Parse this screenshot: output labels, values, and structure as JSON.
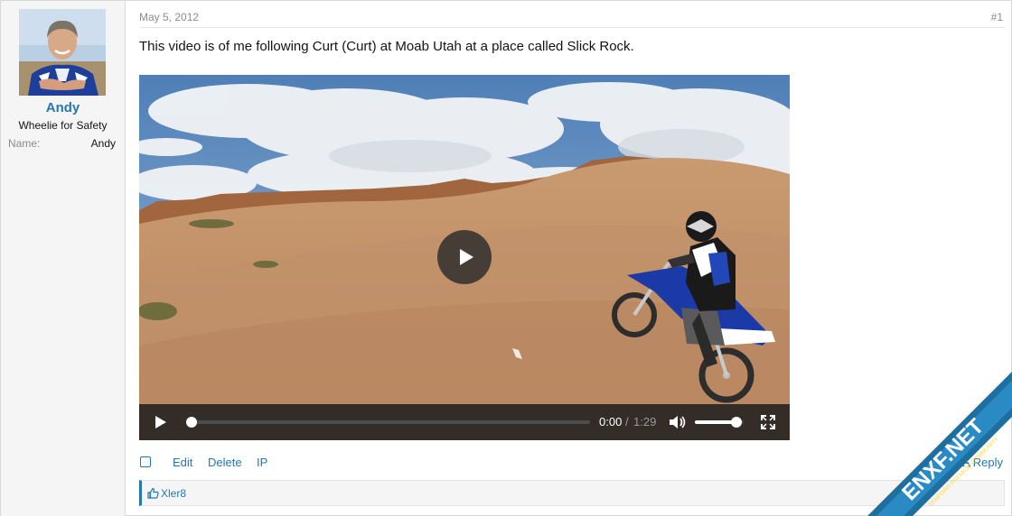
{
  "user": {
    "name": "Andy",
    "title": "Wheelie for Safety",
    "extra_label": "Name:",
    "extra_value": "Andy"
  },
  "post": {
    "date": "May 5, 2012",
    "number": "#1",
    "text": "This video is of me following Curt (Curt) at Moab Utah at a place called Slick Rock."
  },
  "video": {
    "current_time": "0:00",
    "separator": "/",
    "duration": "1:29",
    "progress": 0.0,
    "volume": 0.85
  },
  "actions": {
    "edit": "Edit",
    "delete": "Delete",
    "ip": "IP",
    "reply": "Reply"
  },
  "likes": {
    "liker": "Xler8"
  },
  "watermark": {
    "brand": "ENXF.NET",
    "tagline": "XENFORO PREMIUM COMMUNITY"
  },
  "colors": {
    "link": "#2577b1",
    "muted": "#8c8c8c",
    "sidebar_bg": "#f5f5f5"
  }
}
